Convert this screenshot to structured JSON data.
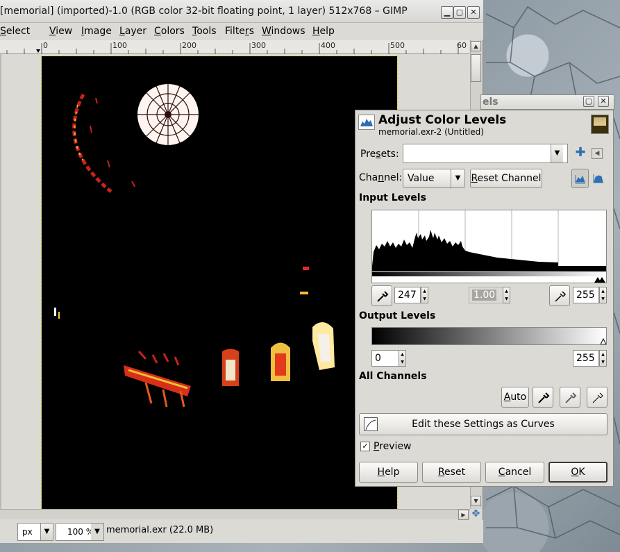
{
  "window": {
    "title": "[memorial] (imported)-1.0 (RGB color 32-bit floating point, 1 layer) 512x768 – GIMP",
    "controls": [
      "minimize-icon",
      "maximize-icon",
      "close-icon"
    ]
  },
  "menu": [
    "Select",
    "View",
    "Image",
    "Layer",
    "Colors",
    "Tools",
    "Filters",
    "Windows",
    "Help"
  ],
  "ruler": {
    "labels": [
      "0",
      "100",
      "200",
      "300",
      "400",
      "500",
      "60"
    ]
  },
  "status": {
    "unit": "px",
    "zoom": "100 %",
    "file": "memorial.exr (22.0 MB)"
  },
  "dock": {
    "title_fragment": "els"
  },
  "dialog": {
    "title": "Adjust Color Levels",
    "subtitle": "memorial.exr-2 (Untitled)",
    "presets_label": "Presets:",
    "presets_value": "",
    "channel_label": "Channel:",
    "channel_value": "Value",
    "reset_channel": "Reset Channel",
    "input_levels": "Input Levels",
    "input_low": "247",
    "input_gamma": "1.00",
    "input_high": "255",
    "output_levels": "Output Levels",
    "output_low": "0",
    "output_high": "255",
    "all_channels": "All Channels",
    "auto": "Auto",
    "edit_curves": "Edit these Settings as Curves",
    "preview": "Preview",
    "preview_checked": true,
    "buttons": {
      "help": "Help",
      "reset": "Reset",
      "cancel": "Cancel",
      "ok": "OK"
    }
  },
  "colors": {
    "image_bg": "#000000",
    "window_bg": "#dcdad5",
    "accent_blue": "#2f6fb6"
  }
}
